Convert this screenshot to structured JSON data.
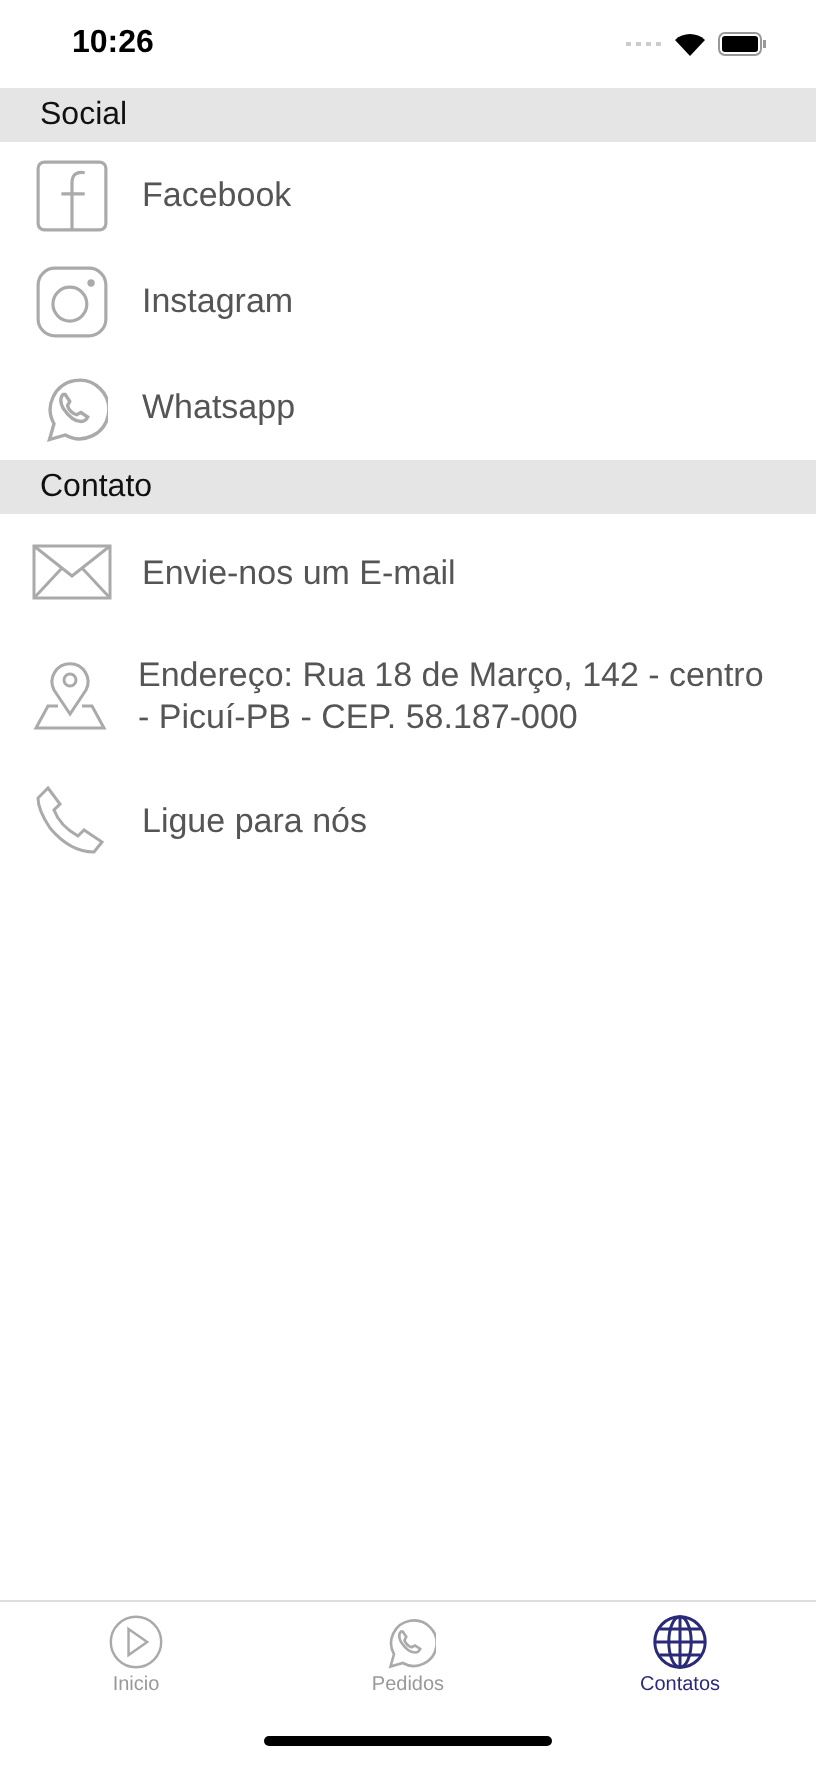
{
  "status_bar": {
    "time": "10:26"
  },
  "sections": [
    {
      "title": "Social",
      "items": [
        {
          "kind": "facebook",
          "label": "Facebook"
        },
        {
          "kind": "instagram",
          "label": "Instagram"
        },
        {
          "kind": "whatsapp",
          "label": "Whatsapp"
        }
      ]
    },
    {
      "title": "Contato",
      "items": [
        {
          "kind": "email",
          "label": "Envie-nos um E-mail"
        },
        {
          "kind": "location",
          "label": "Endereço: Rua 18 de Março, 142 - centro - Picuí-PB - CEP. 58.187-000"
        },
        {
          "kind": "phone",
          "label": "Ligue para nós"
        }
      ]
    }
  ],
  "tabs": [
    {
      "kind": "play",
      "label": "Inicio",
      "selected": false
    },
    {
      "kind": "whatsapp",
      "label": "Pedidos",
      "selected": false
    },
    {
      "kind": "globe",
      "label": "Contatos",
      "selected": true
    }
  ]
}
